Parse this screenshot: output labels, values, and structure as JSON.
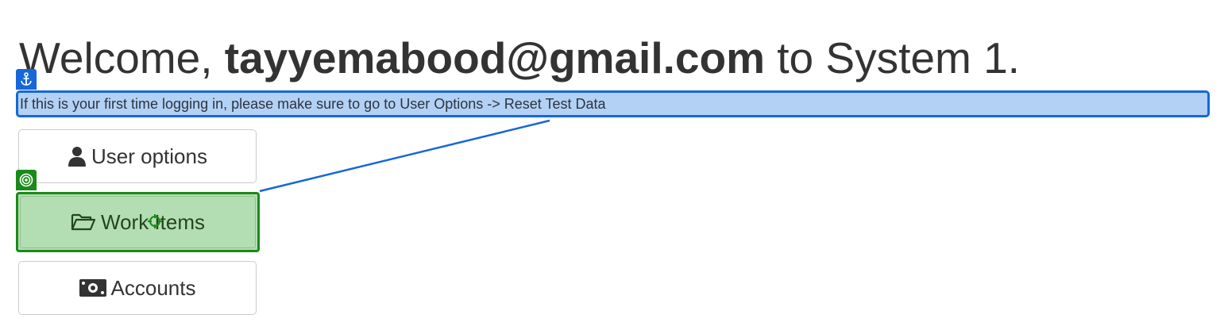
{
  "header": {
    "welcome_prefix": "Welcome, ",
    "user_email": "tayyemabood@gmail.com",
    "welcome_suffix": " to System 1."
  },
  "notice": {
    "text": "If this is your first time logging in, please make sure to go to User Options -> Reset Test Data"
  },
  "menu": {
    "user_options": {
      "label": "User options",
      "icon": "user-icon"
    },
    "work_items": {
      "label": "Work Items",
      "icon": "folder-open-icon"
    },
    "accounts": {
      "label": "Accounts",
      "icon": "money-icon"
    }
  },
  "annotations": {
    "anchor_icon": "anchor-icon",
    "target_icon": "target-icon",
    "anchor_color": "#1667d8",
    "target_color": "#1a8a1a"
  }
}
